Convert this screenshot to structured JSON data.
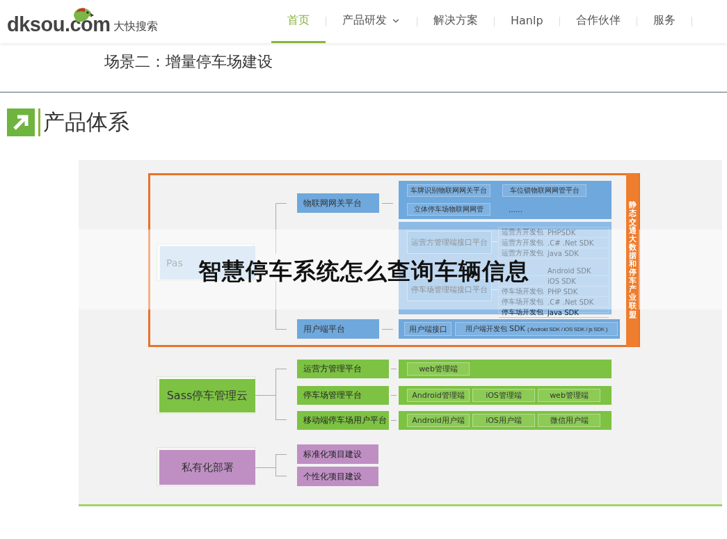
{
  "header": {
    "logo": {
      "brand": "dksou.com",
      "tagline": "大快搜索"
    },
    "nav": [
      {
        "label": "首页",
        "selected": true,
        "has_menu": false
      },
      {
        "label": "产品研发",
        "selected": false,
        "has_menu": true
      },
      {
        "label": "解决方案",
        "selected": false,
        "has_menu": false
      },
      {
        "label": "Hanlp",
        "selected": false,
        "has_menu": false
      },
      {
        "label": "合作伙伴",
        "selected": false,
        "has_menu": false
      },
      {
        "label": "服务",
        "selected": false,
        "has_menu": false
      }
    ]
  },
  "section_heading": "场景二：增量停车场建设",
  "product_title": "产品体系",
  "diagram": {
    "paas": {
      "label": "Pas",
      "side_label": "静态交通大数据和停车产业联盟",
      "gateway": {
        "label": "物联网网关平台",
        "items": [
          "车牌识别物联网网关平台",
          "车位锁物联网网管平台",
          "立体停车场物联网网管",
          "……"
        ]
      },
      "interfaces": [
        {
          "label": "运营方管理端接口平台"
        },
        {
          "label": "停车场管理端接口平台"
        }
      ],
      "sdk_groups": [
        [
          {
            "prefix": "运营方开发包",
            "sdk": "PHPSDK"
          },
          {
            "prefix": "运营方开发包",
            "sdk": ".C# .Net SDK"
          },
          {
            "prefix": "运营方开发包",
            "sdk": "java SDK"
          }
        ],
        [
          {
            "sdk": "Android SDK"
          },
          {
            "sdk": "iOS SDK"
          },
          {
            "prefix": "停车场开发包",
            "sdk": "PHP SDK"
          },
          {
            "prefix": "停车场开发包",
            "sdk": ".C# .Net SDK"
          },
          {
            "prefix": "停车场开发包",
            "sdk": "java SDK"
          }
        ]
      ],
      "user": {
        "label": "用户端平台",
        "interface": "用户端接口",
        "dev_prefix": "用户端开发包",
        "dev_sdk": "SDK",
        "dev_note": "( Android SDK / iOS SDK / js SDK )"
      }
    },
    "saas": {
      "label": "Sass停车管理云",
      "platforms": [
        {
          "label": "运营方管理平台",
          "clients": [
            "web管理端"
          ]
        },
        {
          "label": "停车场管理平台",
          "clients": [
            "Android管理端",
            "iOS管理端",
            "web管理端"
          ]
        },
        {
          "label": "移动端停车场用户平台",
          "clients": [
            "Android用户端",
            "iOS用户端",
            "微信用户端"
          ]
        }
      ]
    },
    "private": {
      "label": "私有化部署",
      "items": [
        "标准化项目建设",
        "个性化项目建设"
      ]
    }
  },
  "overlay_title": "智慧停车系统怎么查询车辆信息"
}
